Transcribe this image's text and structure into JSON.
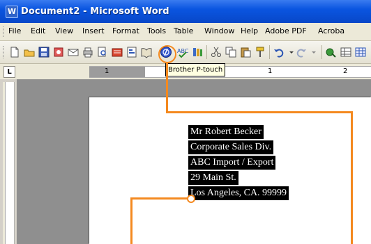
{
  "window": {
    "title": "Document2 - Microsoft Word",
    "app_icon_glyph": "W"
  },
  "menu": {
    "items": [
      "File",
      "Edit",
      "View",
      "Insert",
      "Format",
      "Tools",
      "Table",
      "Window",
      "Help",
      "Adobe PDF",
      "Acroba"
    ]
  },
  "toolbar": {
    "buttons": [
      "new-icon",
      "open-icon",
      "save-icon",
      "permission-icon",
      "email-icon",
      "print-icon",
      "print-preview-icon",
      "research-icon",
      "brother-ptouch-icon",
      "spelling-icon",
      "research-books-icon",
      "cut-icon",
      "copy-icon",
      "paste-icon",
      "format-painter-icon",
      "undo-icon",
      "redo-icon",
      "hyperlink-icon"
    ],
    "tooltip": "Brother P-touch"
  },
  "ruler": {
    "tab_selector": "L",
    "numbers": [
      "1",
      "1",
      "2"
    ]
  },
  "document": {
    "address_lines": [
      "Mr Robert Becker",
      "Corporate Sales Div.",
      "ABC Import / Export",
      "29 Main St.",
      "Los Angeles, CA. 99999"
    ]
  },
  "colors": {
    "callout": "#f4891f",
    "titlebar": "#0a55e0",
    "selection": "#000000"
  }
}
